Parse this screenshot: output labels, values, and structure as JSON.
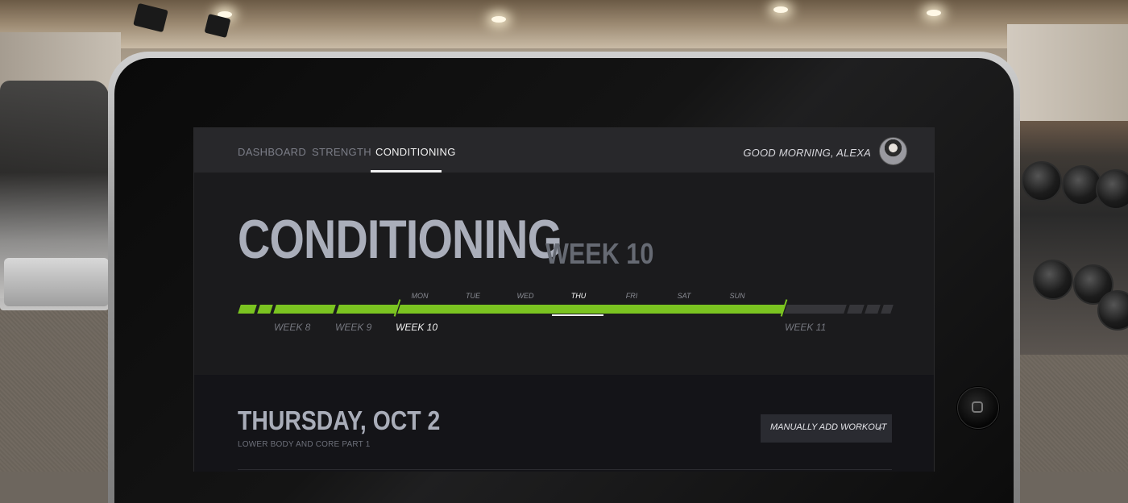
{
  "nav": {
    "tabs": [
      {
        "label": "DASHBOARD",
        "active": false
      },
      {
        "label": "STRENGTH",
        "active": false
      },
      {
        "label": "CONDITIONING",
        "active": true
      }
    ],
    "greeting": "GOOD MORNING, ALEXA"
  },
  "header": {
    "title": "CONDITIONING",
    "week": "WEEK 10"
  },
  "timeline": {
    "weeks": [
      {
        "label": "WEEK 8",
        "current": false
      },
      {
        "label": "WEEK 9",
        "current": false
      },
      {
        "label": "WEEK 10",
        "current": true
      },
      {
        "label": "WEEK 11",
        "current": false
      }
    ],
    "days": [
      "MON",
      "TUE",
      "WED",
      "THU",
      "FRI",
      "SAT",
      "SUN"
    ],
    "current_day": "THU",
    "accent_color": "#7bc421"
  },
  "workout": {
    "date": "THURSDAY, OCT 2",
    "subtitle": "LOWER BODY AND CORE PART 1",
    "add_button": "MANUALLY ADD WORKOUT",
    "add_icon": "+"
  }
}
